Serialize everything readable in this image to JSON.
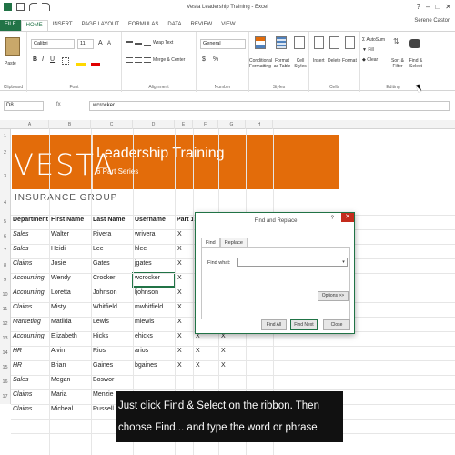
{
  "window": {
    "title": "Vesta Leadership Training - Excel",
    "user": "Serene Castor",
    "controls": [
      "?",
      "–",
      "□",
      "✕"
    ]
  },
  "tabs": [
    "FILE",
    "HOME",
    "INSERT",
    "PAGE LAYOUT",
    "FORMULAS",
    "DATA",
    "REVIEW",
    "VIEW"
  ],
  "ribbon": {
    "clipboard": {
      "paste": "Paste",
      "label": "Clipboard"
    },
    "font": {
      "name": "Calibri",
      "size": "11",
      "label": "Font",
      "bold": "B",
      "italic": "I",
      "underline": "U"
    },
    "alignment": {
      "wrap": "Wrap Text",
      "merge": "Merge & Center",
      "label": "Alignment"
    },
    "number": {
      "format": "General",
      "label": "Number",
      "dollar": "$",
      "percent": "%"
    },
    "styles": {
      "conditional": "Conditional Formatting",
      "format_table": "Format as Table",
      "cell_styles": "Cell Styles",
      "label": "Styles"
    },
    "cells": {
      "insert": "Insert",
      "delete": "Delete",
      "format": "Format",
      "label": "Cells"
    },
    "editing": {
      "autosum": "AutoSum",
      "fill": "Fill",
      "clear": "Clear",
      "sort": "Sort & Filter",
      "find": "Find & Select",
      "label": "Editing"
    }
  },
  "formula_bar": {
    "name_box": "D8",
    "fx": "fx",
    "value": "wcrocker"
  },
  "columns": [
    "A",
    "B",
    "C",
    "D",
    "E",
    "F",
    "G",
    "H"
  ],
  "rows": [
    "1",
    "2",
    "3",
    "4",
    "5",
    "6",
    "7",
    "8",
    "9",
    "10",
    "11",
    "12",
    "13",
    "14",
    "15",
    "16",
    "17"
  ],
  "banner": {
    "brand": "VESTA",
    "title": "Leadership Training",
    "subtitle": "6 Part Series",
    "group": "INSURANCE GROUP"
  },
  "table": {
    "headers": [
      "Department",
      "First Name",
      "Last Name",
      "Username",
      "Part 1"
    ],
    "rows": [
      [
        "Sales",
        "Walter",
        "Rivera",
        "wrivera",
        "X",
        "",
        ""
      ],
      [
        "Sales",
        "Heidi",
        "Lee",
        "hlee",
        "X",
        "",
        ""
      ],
      [
        "Claims",
        "Josie",
        "Gates",
        "jgates",
        "X",
        "",
        ""
      ],
      [
        "Accounting",
        "Wendy",
        "Crocker",
        "wcrocker",
        "X",
        "",
        ""
      ],
      [
        "Accounting",
        "Loretta",
        "Johnson",
        "ljohnson",
        "X",
        "",
        ""
      ],
      [
        "Claims",
        "Misty",
        "Whitfield",
        "mwhitfield",
        "X",
        "",
        ""
      ],
      [
        "Marketing",
        "Matilda",
        "Lewis",
        "mlewis",
        "X",
        "",
        ""
      ],
      [
        "Accounting",
        "Elizabeth",
        "Hicks",
        "ehicks",
        "X",
        "X",
        "X"
      ],
      [
        "HR",
        "Alvin",
        "Rios",
        "arios",
        "X",
        "X",
        "X"
      ],
      [
        "HR",
        "Brian",
        "Gaines",
        "bgaines",
        "X",
        "X",
        "X"
      ],
      [
        "Sales",
        "Megan",
        "Boswor",
        "",
        "",
        "",
        ""
      ],
      [
        "Claims",
        "Maria",
        "Menzie",
        "",
        "",
        "",
        ""
      ],
      [
        "Claims",
        "Micheal",
        "Russell",
        "",
        "",
        "",
        ""
      ]
    ]
  },
  "dialog": {
    "title": "Find and Replace",
    "help": "?",
    "close": "✕",
    "tabs": [
      "Find",
      "Replace"
    ],
    "find_label": "Find what:",
    "find_value": "",
    "options": "Options >>",
    "find_all": "Find All",
    "find_next": "Find Next",
    "close_btn": "Close"
  },
  "caption": {
    "line1": "Just click Find & Select on the ribbon. Then",
    "line2": "choose Find... and type the word or phrase"
  }
}
